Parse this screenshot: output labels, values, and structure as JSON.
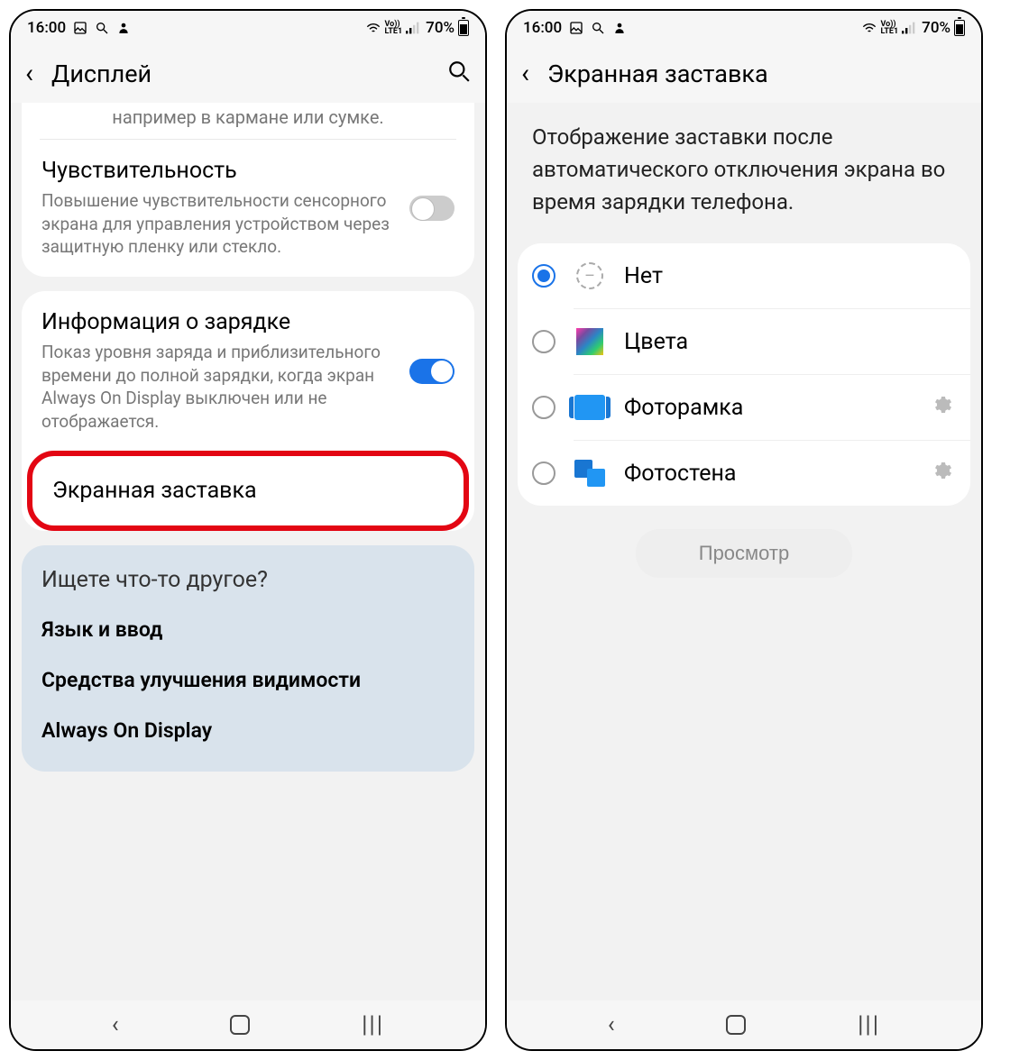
{
  "statusbar": {
    "time": "16:00",
    "battery_pct": "70%",
    "volte": "Vo))\nLTE1"
  },
  "left_screen": {
    "title": "Дисплей",
    "truncated_prev": "например в кармане или сумке.",
    "sensitivity": {
      "title": "Чувствительность",
      "desc": "Повышение чувствительности сенсорного экрана для управления устройством через защитную пленку или стекло."
    },
    "charging_info": {
      "title": "Информация о зарядке",
      "desc": "Показ уровня заряда и приблизительного времени до полной зарядки, когда экран Always On Display выключен или не отображается."
    },
    "screensaver": {
      "title": "Экранная заставка"
    },
    "looking": {
      "heading": "Ищете что-то другое?",
      "links": [
        "Язык и ввод",
        "Средства улучшения видимости",
        "Always On Display"
      ]
    }
  },
  "right_screen": {
    "title": "Экранная заставка",
    "description": "Отображение заставки после автоматического отключения экрана во время зарядки телефона.",
    "options": [
      {
        "label": "Нет",
        "checked": true,
        "gear": false,
        "icon": "none"
      },
      {
        "label": "Цвета",
        "checked": false,
        "gear": false,
        "icon": "colors"
      },
      {
        "label": "Фоторамка",
        "checked": false,
        "gear": true,
        "icon": "frame"
      },
      {
        "label": "Фотостена",
        "checked": false,
        "gear": true,
        "icon": "wall"
      }
    ],
    "preview_label": "Просмотр"
  }
}
